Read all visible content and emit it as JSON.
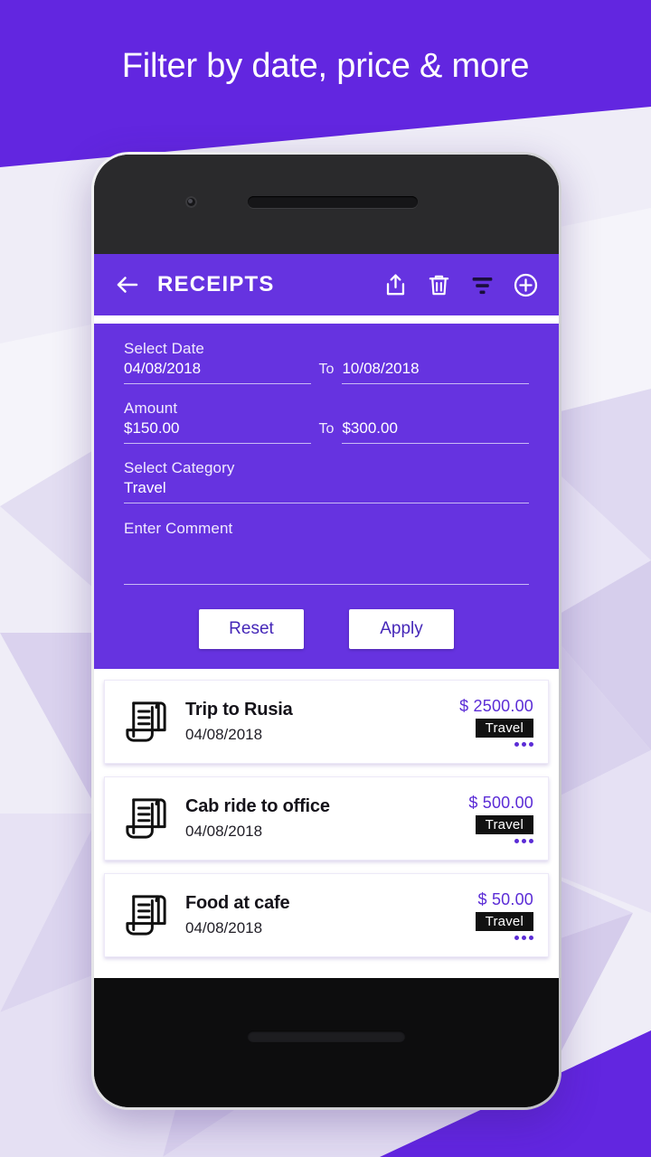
{
  "promo": {
    "headline": "Filter by date, price & more"
  },
  "colors": {
    "banner_purple": "#6226E0",
    "app_purple": "#6633E0",
    "accent_purple": "#5B2CD6",
    "button_text": "#4527B8",
    "badge_bg": "#111111",
    "background": "#EDEAF6"
  },
  "appbar": {
    "title": "RECEIPTS",
    "back_icon": "arrow-left-icon",
    "actions": [
      {
        "name": "share-icon",
        "label": "Share"
      },
      {
        "name": "delete-icon",
        "label": "Delete"
      },
      {
        "name": "filter-icon",
        "label": "Filter",
        "active": true
      },
      {
        "name": "add-icon",
        "label": "Add"
      }
    ]
  },
  "filter": {
    "date": {
      "label": "Select Date",
      "from_value": "04/08/2018",
      "to_separator": "To",
      "to_value": "10/08/2018"
    },
    "amount": {
      "label": "Amount",
      "from_value": "$150.00",
      "to_separator": "To",
      "to_value": "$300.00"
    },
    "category": {
      "label": "Select Category",
      "value": "Travel"
    },
    "comment": {
      "label": "Enter Comment",
      "value": ""
    },
    "reset_label": "Reset",
    "apply_label": "Apply"
  },
  "receipts": [
    {
      "icon": "receipt-scroll-icon",
      "title": "Trip to Rusia",
      "date": "04/08/2018",
      "amount": "$ 2500.00",
      "category": "Travel",
      "more": "more-options-icon"
    },
    {
      "icon": "receipt-scroll-icon",
      "title": "Cab ride to office",
      "date": "04/08/2018",
      "amount": "$ 500.00",
      "category": "Travel",
      "more": "more-options-icon"
    },
    {
      "icon": "receipt-scroll-icon",
      "title": "Food at cafe",
      "date": "04/08/2018",
      "amount": "$ 50.00",
      "category": "Travel",
      "more": "more-options-icon"
    }
  ]
}
